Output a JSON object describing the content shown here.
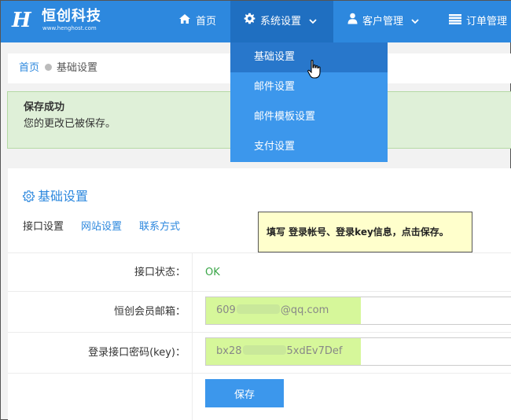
{
  "brand": {
    "name": "恒创科技",
    "url": "www.henghost.com",
    "logo_letter": "H"
  },
  "nav": {
    "home": "首页",
    "system_settings": "系统设置",
    "customer_mgmt": "客户管理",
    "order_mgmt": "订单管理"
  },
  "dropdown": {
    "items": [
      {
        "label": "基础设置"
      },
      {
        "label": "邮件设置"
      },
      {
        "label": "邮件模板设置"
      },
      {
        "label": "支付设置"
      }
    ]
  },
  "breadcrumb": {
    "home": "首页",
    "current": "基础设置"
  },
  "alert": {
    "title": "保存成功",
    "message": "您的更改已被保存。"
  },
  "panel": {
    "title": "基础设置",
    "tabs": [
      {
        "label": "接口设置"
      },
      {
        "label": "网站设置"
      },
      {
        "label": "联系方式"
      }
    ]
  },
  "form": {
    "status_label": "接口状态：",
    "status_value": "OK",
    "email_label": "恒创会员邮箱：",
    "email_prefix": "609",
    "email_suffix": "@qq.com",
    "key_label": "登录接口密码(key)：",
    "key_prefix": "bx28",
    "key_suffix": "5xdEv7Def",
    "save_label": "保存"
  },
  "note": {
    "text": "填写 登录帐号、登录key信息，点击保存。"
  },
  "colors": {
    "primary": "#2d88de",
    "nav_active": "#1f6fc1",
    "dropdown_bg": "#3c97ec",
    "success_bg": "#dff0d8",
    "ok_text": "#3aa648",
    "field_highlight": "#d6f79a",
    "note_bg": "#ffffcc"
  }
}
